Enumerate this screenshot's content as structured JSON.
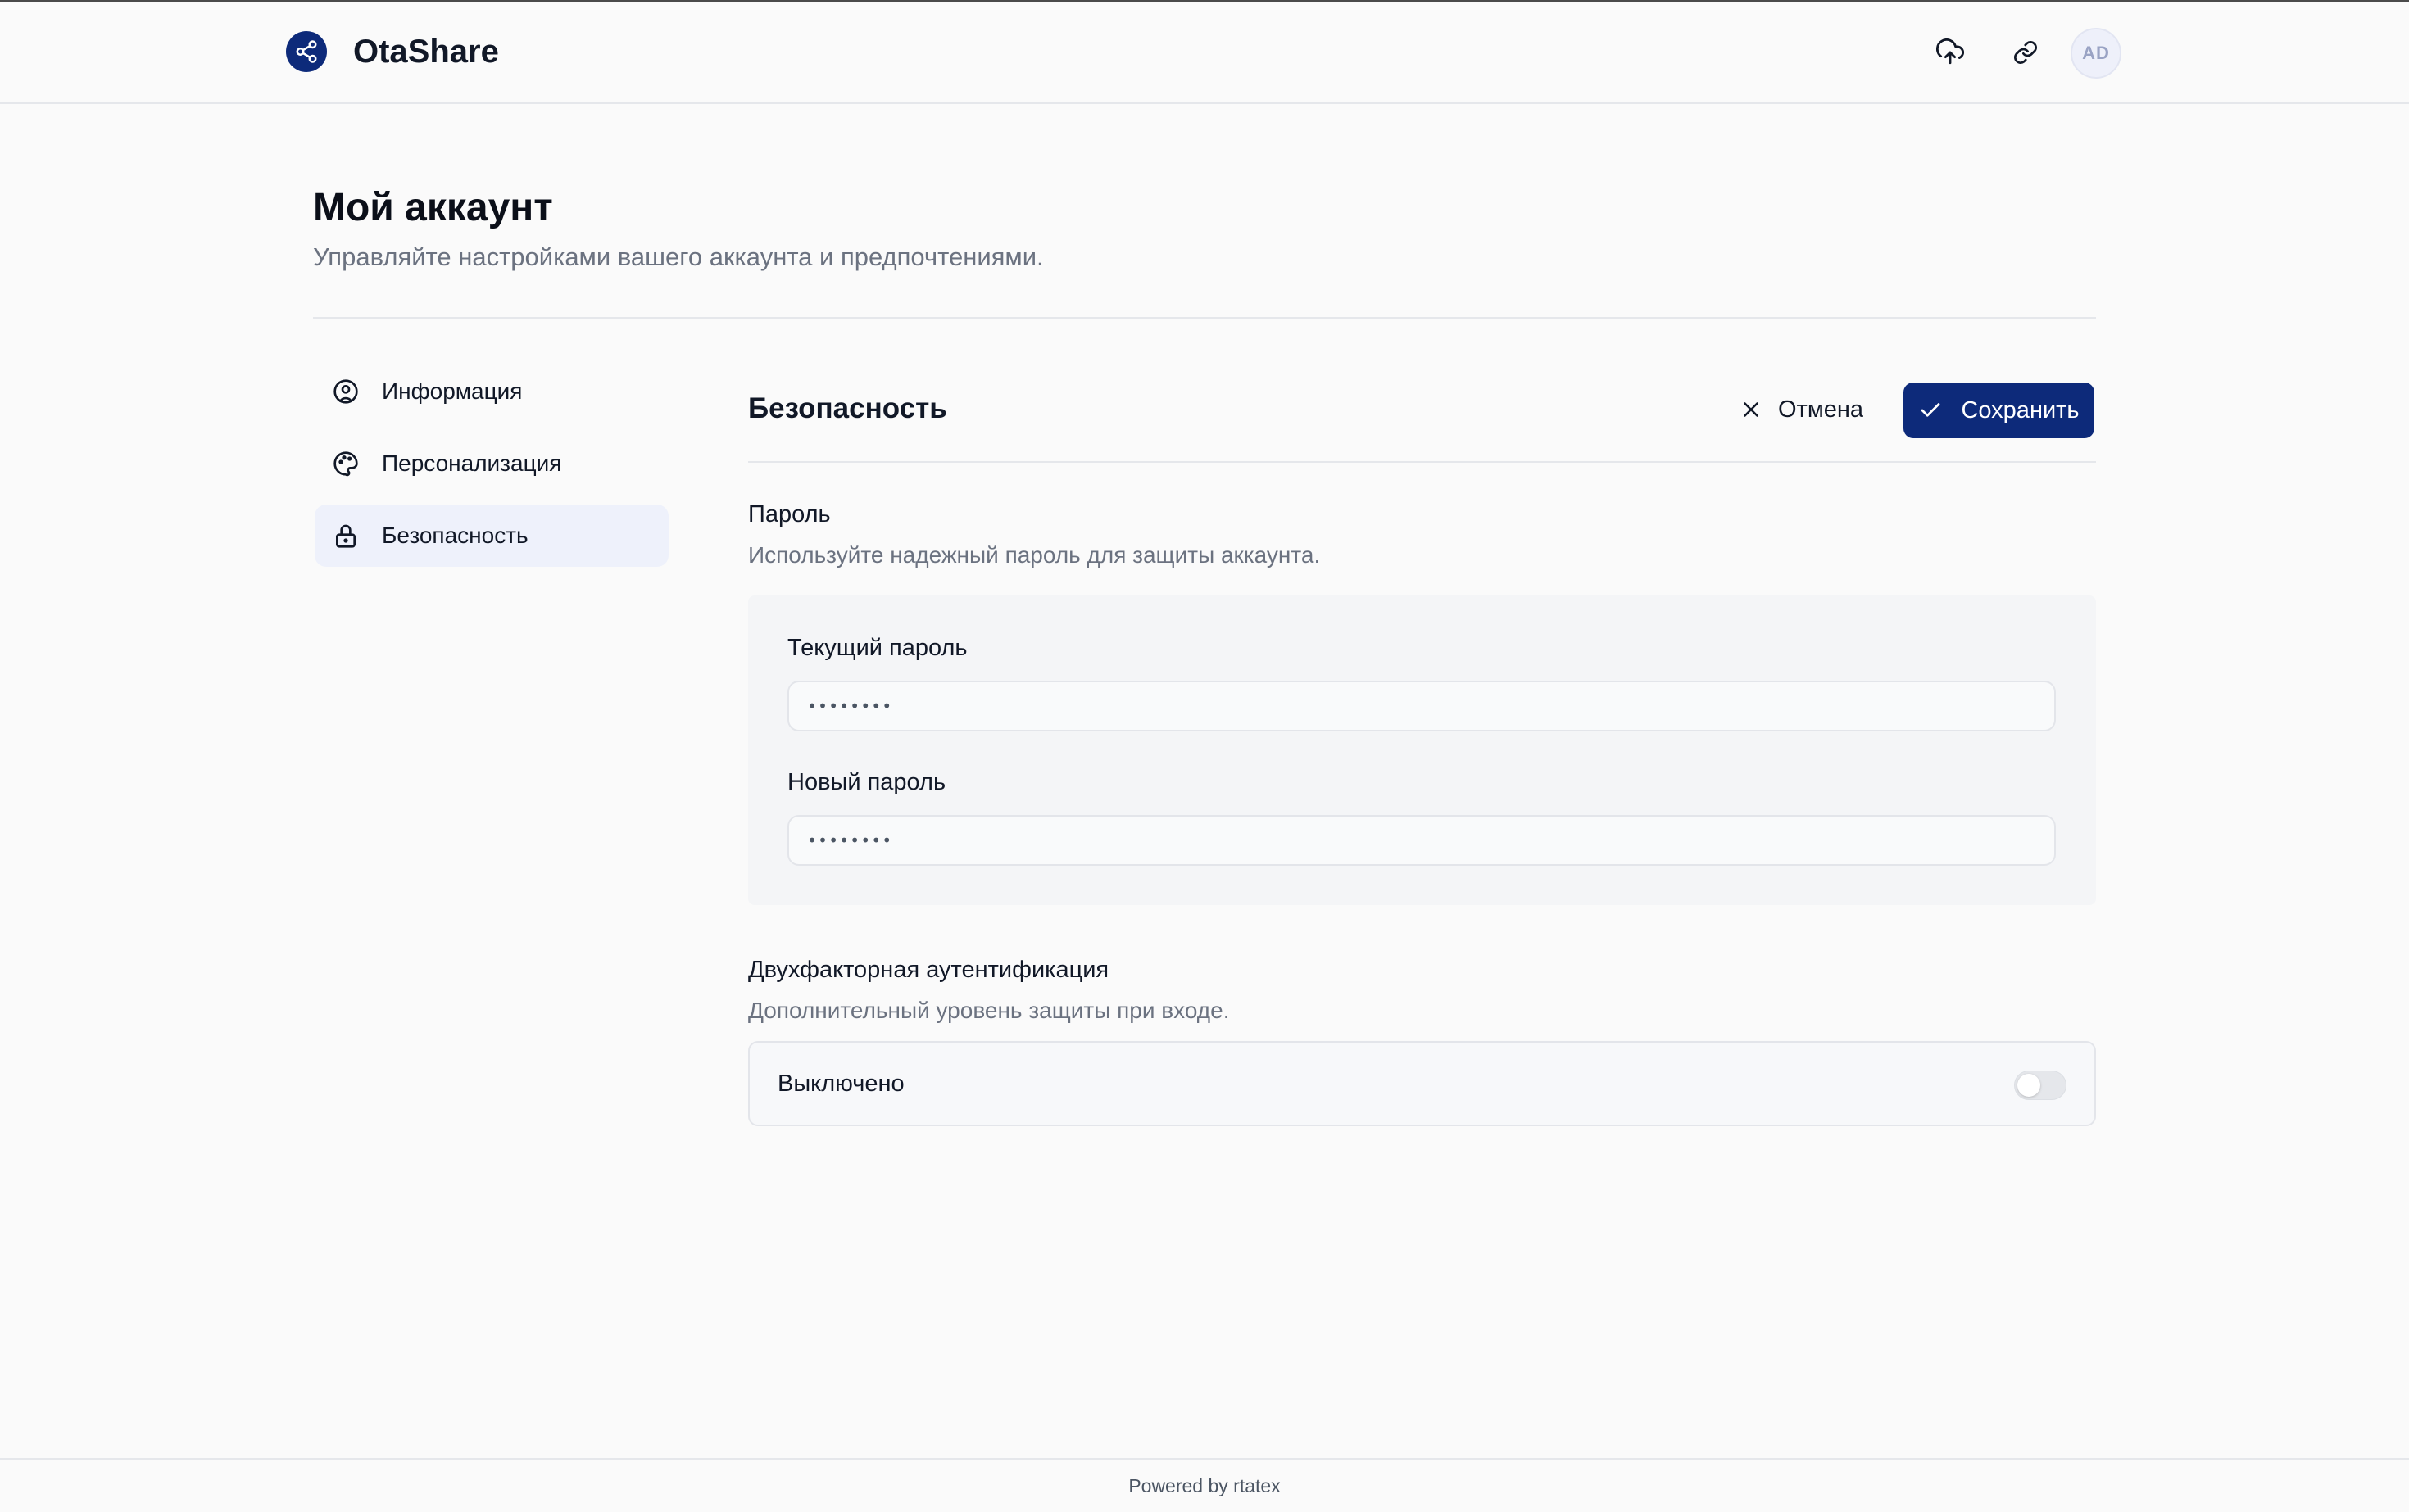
{
  "app": {
    "name": "OtaShare",
    "avatar_initials": "AD",
    "brand_color": "#0d2a7a",
    "icons": [
      "share-icon",
      "cloud-upload-icon",
      "link-icon"
    ]
  },
  "page": {
    "title": "Мой аккаунт",
    "subtitle": "Управляйте настройками вашего аккаунта и предпочтениями."
  },
  "sidebar": {
    "items": [
      {
        "label": "Информация",
        "icon": "user-circle-icon",
        "active": false
      },
      {
        "label": "Персонализация",
        "icon": "palette-icon",
        "active": false
      },
      {
        "label": "Безопасность",
        "icon": "lock-icon",
        "active": true
      }
    ]
  },
  "section": {
    "title": "Безопасность",
    "cancel_label": "Отмена",
    "save_label": "Сохранить"
  },
  "password": {
    "heading": "Пароль",
    "hint": "Используйте надежный пароль для защиты аккаунта.",
    "current_label": "Текущий пароль",
    "current_value": "••••••••",
    "new_label": "Новый пароль",
    "new_value": "••••••••"
  },
  "twofa": {
    "heading": "Двухфакторная аутентификация",
    "hint": "Дополнительный уровень защиты при входе.",
    "status_label": "Выключено",
    "enabled": false
  },
  "footer": {
    "text": "Powered by rtatex"
  }
}
